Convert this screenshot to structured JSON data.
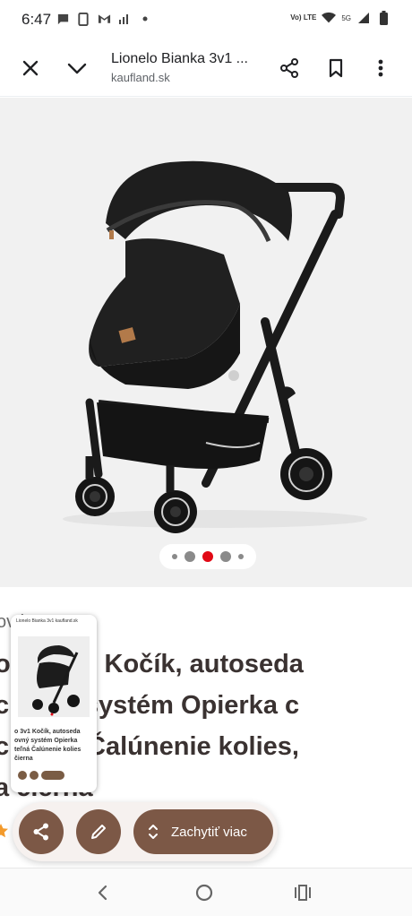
{
  "status_bar": {
    "time": "6:47",
    "network_label": "Vo) LTE",
    "network_type": "5G",
    "icons": [
      "chat-icon",
      "sim-icon",
      "gmail-icon",
      "signal-bars-icon",
      "dot-icon",
      "wifi-icon",
      "cell-signal-icon",
      "battery-icon"
    ]
  },
  "header": {
    "title": "Lionelo Bianka 3v1 ...",
    "domain": "kaufland.sk",
    "actions": [
      "close-icon",
      "chevron-down-icon",
      "share-icon",
      "bookmark-icon",
      "more-vert-icon"
    ]
  },
  "gallery": {
    "total_images": 5,
    "active_index": 2,
    "active_color": "#e10915"
  },
  "product": {
    "breadcrumb": "ov          ky",
    "title_lines": [
      "o           ka 3v1 Kočík, autoseda",
      "c           ovný systém Opierka c",
      "c           teľná Čalúnenie kolies,",
      "a            čierna"
    ]
  },
  "thumbnail": {
    "header_text": "Lionelo Bianka 3v1 kaufland.sk",
    "text_lines": [
      "o 3v1 Kočík, autoseda",
      "ovný systém Opierka",
      "teľná Čalúnenie kolies",
      "čierna"
    ]
  },
  "capture_toolbar": {
    "pill_label": "Zachytiť viac",
    "accent_color": "#7c5846"
  },
  "nav_bar": {
    "buttons": [
      "back-icon",
      "home-icon",
      "recent-apps-icon"
    ]
  }
}
